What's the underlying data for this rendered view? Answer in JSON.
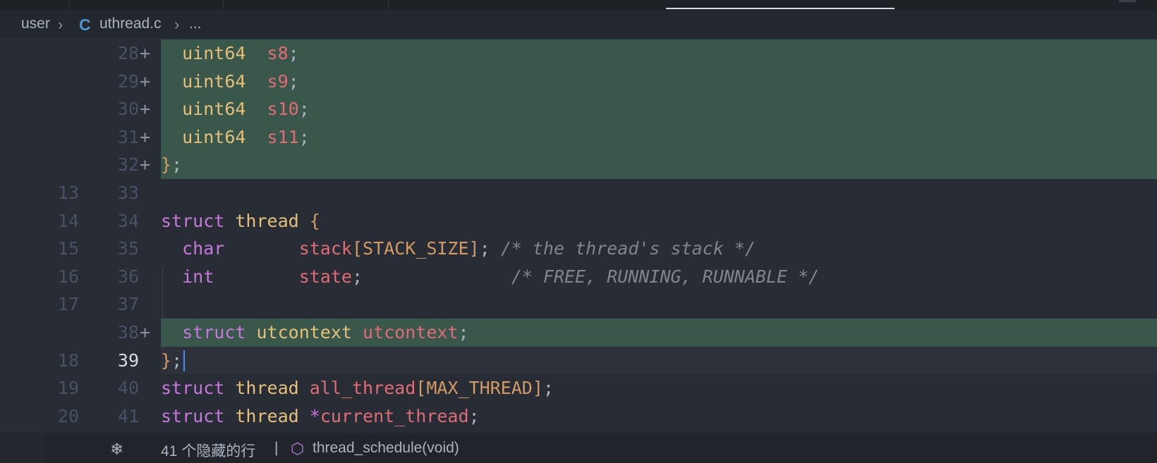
{
  "breadcrumb": {
    "folder": "user",
    "file_lang_icon": "C",
    "file": "uthread.c",
    "more": "..."
  },
  "code_lines": [
    {
      "old": "",
      "new": "28",
      "marker": "+",
      "type": "added",
      "tokens": [
        [
          "",
          "  "
        ],
        [
          "ty",
          "uint64"
        ],
        [
          "",
          "  "
        ],
        [
          "id",
          "s8"
        ],
        [
          "pn",
          ";"
        ]
      ]
    },
    {
      "old": "",
      "new": "29",
      "marker": "+",
      "type": "added",
      "tokens": [
        [
          "",
          "  "
        ],
        [
          "ty",
          "uint64"
        ],
        [
          "",
          "  "
        ],
        [
          "id",
          "s9"
        ],
        [
          "pn",
          ";"
        ]
      ]
    },
    {
      "old": "",
      "new": "30",
      "marker": "+",
      "type": "added",
      "tokens": [
        [
          "",
          "  "
        ],
        [
          "ty",
          "uint64"
        ],
        [
          "",
          "  "
        ],
        [
          "id",
          "s10"
        ],
        [
          "pn",
          ";"
        ]
      ]
    },
    {
      "old": "",
      "new": "31",
      "marker": "+",
      "type": "added",
      "tokens": [
        [
          "",
          "  "
        ],
        [
          "ty",
          "uint64"
        ],
        [
          "",
          "  "
        ],
        [
          "id",
          "s11"
        ],
        [
          "pn",
          ";"
        ]
      ]
    },
    {
      "old": "",
      "new": "32",
      "marker": "+",
      "type": "added",
      "tokens": [
        [
          "bk",
          "}"
        ],
        [
          "pn",
          ";"
        ]
      ]
    },
    {
      "old": "13",
      "new": "33",
      "marker": "",
      "type": "normal",
      "tokens": []
    },
    {
      "old": "14",
      "new": "34",
      "marker": "",
      "type": "normal",
      "tokens": [
        [
          "kw",
          "struct"
        ],
        [
          "",
          " "
        ],
        [
          "ty",
          "thread"
        ],
        [
          "",
          " "
        ],
        [
          "bk",
          "{"
        ]
      ]
    },
    {
      "old": "15",
      "new": "35",
      "marker": "",
      "type": "normal",
      "tokens": [
        [
          "",
          "  "
        ],
        [
          "kw",
          "char"
        ],
        [
          "",
          "       "
        ],
        [
          "id",
          "stack"
        ],
        [
          "bk",
          "["
        ],
        [
          "mc",
          "STACK_SIZE"
        ],
        [
          "bk",
          "]"
        ],
        [
          "pn",
          ";"
        ],
        [
          "",
          " "
        ],
        [
          "cm",
          "/* the thread's stack */"
        ]
      ]
    },
    {
      "old": "16",
      "new": "36",
      "marker": "",
      "type": "normal",
      "tokens": [
        [
          "",
          "  "
        ],
        [
          "kw",
          "int"
        ],
        [
          "",
          "        "
        ],
        [
          "id",
          "state"
        ],
        [
          "pn",
          ";"
        ],
        [
          "",
          "              "
        ],
        [
          "cm",
          "/* FREE, RUNNING, RUNNABLE */"
        ]
      ]
    },
    {
      "old": "17",
      "new": "37",
      "marker": "",
      "type": "normal",
      "tokens": []
    },
    {
      "old": "",
      "new": "38",
      "marker": "+",
      "type": "added",
      "tokens": [
        [
          "",
          "  "
        ],
        [
          "kw",
          "struct"
        ],
        [
          "",
          " "
        ],
        [
          "ty",
          "utcontext"
        ],
        [
          "",
          " "
        ],
        [
          "id",
          "utcontext"
        ],
        [
          "pn",
          ";"
        ]
      ]
    },
    {
      "old": "18",
      "new": "39",
      "marker": "",
      "type": "current",
      "tokens": [
        [
          "bk",
          "}"
        ],
        [
          "pn",
          ";"
        ]
      ]
    },
    {
      "old": "19",
      "new": "40",
      "marker": "",
      "type": "normal",
      "tokens": [
        [
          "kw",
          "struct"
        ],
        [
          "",
          " "
        ],
        [
          "ty",
          "thread"
        ],
        [
          "",
          " "
        ],
        [
          "id",
          "all_thread"
        ],
        [
          "bk",
          "["
        ],
        [
          "mc",
          "MAX_THREAD"
        ],
        [
          "bk",
          "]"
        ],
        [
          "pn",
          ";"
        ]
      ]
    },
    {
      "old": "20",
      "new": "41",
      "marker": "",
      "type": "normal",
      "tokens": [
        [
          "kw",
          "struct"
        ],
        [
          "",
          " "
        ],
        [
          "ty",
          "thread"
        ],
        [
          "",
          " "
        ],
        [
          "kw",
          "*"
        ],
        [
          "id",
          "current_thread"
        ],
        [
          "pn",
          ";"
        ]
      ]
    }
  ],
  "footer": {
    "fold_icon": "fold-icon",
    "hidden_lines": "41 个隐藏的行",
    "separator": "|",
    "symbol_icon": "cube-icon",
    "symbol": "thread_schedule(void)"
  },
  "colors": {
    "added_bg": "#3a574b",
    "editor_bg": "#282c34",
    "keyword": "#c678dd",
    "type": "#e5c07b",
    "identifier": "#e06c75",
    "comment": "#7f848e"
  }
}
